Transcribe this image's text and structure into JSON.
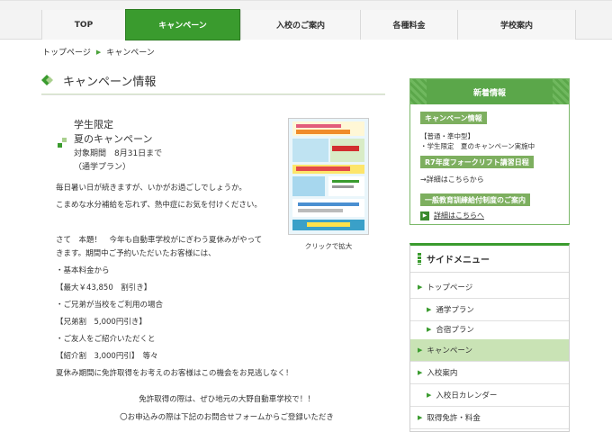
{
  "nav": {
    "items": [
      {
        "label": "TOP"
      },
      {
        "label": "キャンペーン"
      },
      {
        "label": "入校のご案内"
      },
      {
        "label": "各種料金"
      },
      {
        "label": "学校案内"
      }
    ]
  },
  "breadcrumb": {
    "home": "トップページ",
    "current": "キャンペーン"
  },
  "page_title": "キャンペーン情報",
  "campaign": {
    "title1": "学生限定",
    "title2": "夏のキャンペーン",
    "period": "対象期間　8月31日まで",
    "plan": "（通学プラン）"
  },
  "body": [
    "毎日暑い日が続きますが、いかがお過ごしでしょうか。",
    "こまめな水分補給を忘れず、熱中症にお気を付けください。",
    "さて　本題！　今年も自動車学校がにぎわう夏休みがやって",
    "きます。期間中ご予約いただいたお客様には、",
    "・基本料金から",
    "【最大￥43,850　割引き】",
    "・ご兄弟が当校をご利用の場合",
    "【兄弟割　5,000円引き】",
    "・ご友人をご紹介いただくと",
    "【紹介割　3,000円引】　等々",
    "夏休み期間に免許取得をお考えのお客様はこの機会をお見逃しなく！",
    "免許取得の際は、ぜひ地元の大野自動車学校で！！",
    "〇お申込みの際は下記のお問合せフォームからご登録いただき"
  ],
  "flyer": {
    "caption": "クリックで拡大"
  },
  "news": {
    "heading": "新着情報",
    "tag1": "キャンペーン情報",
    "text1a": "【普通・準中型】",
    "text1b": "・学生限定　夏のキャンペーン実施中",
    "tag2": "R7年度フォークリフト講習日程",
    "text2": "→詳細はこちらから",
    "tag3": "一般教育訓練給付制度のご案内",
    "link3": "詳細はこちらへ"
  },
  "sidemenu": {
    "heading": "サイドメニュー",
    "items": [
      {
        "label": "トップページ"
      },
      {
        "label": "通学プラン"
      },
      {
        "label": "合宿プラン"
      },
      {
        "label": "キャンペーン"
      },
      {
        "label": "入校案内"
      },
      {
        "label": "入校日カレンダー"
      },
      {
        "label": "取得免許・料金"
      }
    ]
  },
  "colors": {
    "accent": "#3a9b2e",
    "active_bg": "#c9e3b5"
  }
}
